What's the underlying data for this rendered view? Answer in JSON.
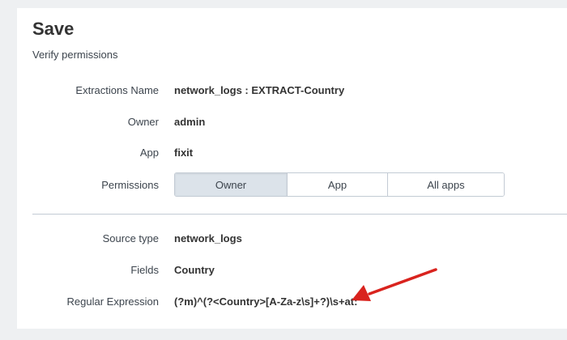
{
  "dialog": {
    "title": "Save",
    "subtitle": "Verify permissions"
  },
  "fields": {
    "extractions_name": {
      "label": "Extractions Name",
      "value": "network_logs : EXTRACT-Country"
    },
    "owner": {
      "label": "Owner",
      "value": "admin"
    },
    "app": {
      "label": "App",
      "value": "fixit"
    },
    "permissions": {
      "label": "Permissions",
      "options": [
        "Owner",
        "App",
        "All apps"
      ],
      "selected": "Owner"
    },
    "source_type": {
      "label": "Source type",
      "value": "network_logs"
    },
    "fields_list": {
      "label": "Fields",
      "value": "Country"
    },
    "regex": {
      "label": "Regular Expression",
      "value": "(?m)^(?<Country>[A-Za-z\\s]+?)\\s+at:"
    }
  },
  "annotation": {
    "arrow_color": "#d9231e",
    "arrow_icon": "arrow-pointer-icon"
  }
}
